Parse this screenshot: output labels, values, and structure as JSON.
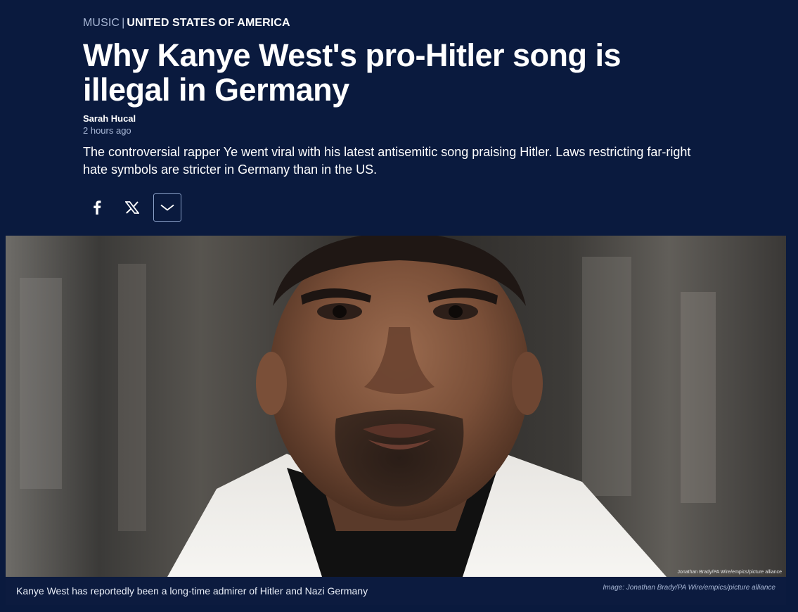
{
  "article": {
    "category": "MUSIC",
    "separator": "|",
    "country": "UNITED STATES OF AMERICA",
    "headline": "Why Kanye West's pro-Hitler song is illegal in Germany",
    "author": "Sarah Hucal",
    "time": "2 hours ago",
    "teaser": "The controversial rapper Ye went viral with his latest antisemitic song praising Hitler. Laws restricting far-right hate symbols are stricter in Germany than in the US."
  },
  "share": {
    "buttons": [
      {
        "icon": "facebook-icon"
      },
      {
        "icon": "x-icon"
      },
      {
        "icon": "chevron-down-icon"
      }
    ]
  },
  "image": {
    "overlay_credit": "Jonathan Brady/PA Wire/empics/picture alliance",
    "caption": "Kanye West has reportedly been a long-time admirer of Hitler and Nazi Germany",
    "credit": "Image: Jonathan Brady/PA Wire/empics/picture alliance"
  },
  "colors": {
    "background": "#0a1a3e",
    "caption_background": "#0c1b3f",
    "kicker_muted": "#a9b8d6",
    "button_border": "#8aa0c8"
  }
}
